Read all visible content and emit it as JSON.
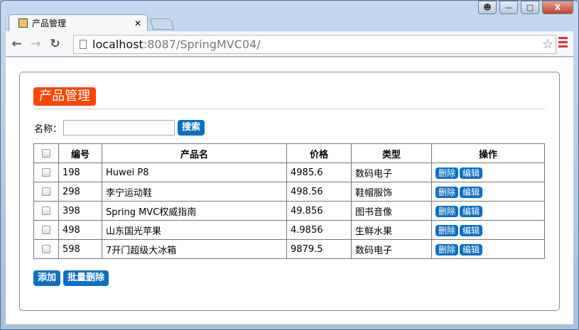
{
  "browser": {
    "tab_title": "产品管理",
    "url_host": "localhost",
    "url_rest": ":8087/SpringMVC04/"
  },
  "page": {
    "heading": "产品管理",
    "search": {
      "label": "名称：",
      "value": "",
      "button": "搜索"
    },
    "table": {
      "headers": [
        "编号",
        "产品名",
        "价格",
        "类型",
        "操作"
      ],
      "rows": [
        {
          "id": "198",
          "name": "Huwei P8",
          "price": "4985.6",
          "type": "数码电子"
        },
        {
          "id": "298",
          "name": "李宁运动鞋",
          "price": "498.56",
          "type": "鞋帽服饰"
        },
        {
          "id": "398",
          "name": "Spring MVC权威指南",
          "price": "49.856",
          "type": "图书音像"
        },
        {
          "id": "498",
          "name": "山东国光苹果",
          "price": "4.9856",
          "type": "生鲜水果"
        },
        {
          "id": "598",
          "name": "7开门超级大冰箱",
          "price": "9879.5",
          "type": "数码电子"
        }
      ],
      "delete_label": "删除",
      "edit_label": "编辑"
    },
    "add_button": "添加",
    "batch_delete_button": "批量删除"
  }
}
